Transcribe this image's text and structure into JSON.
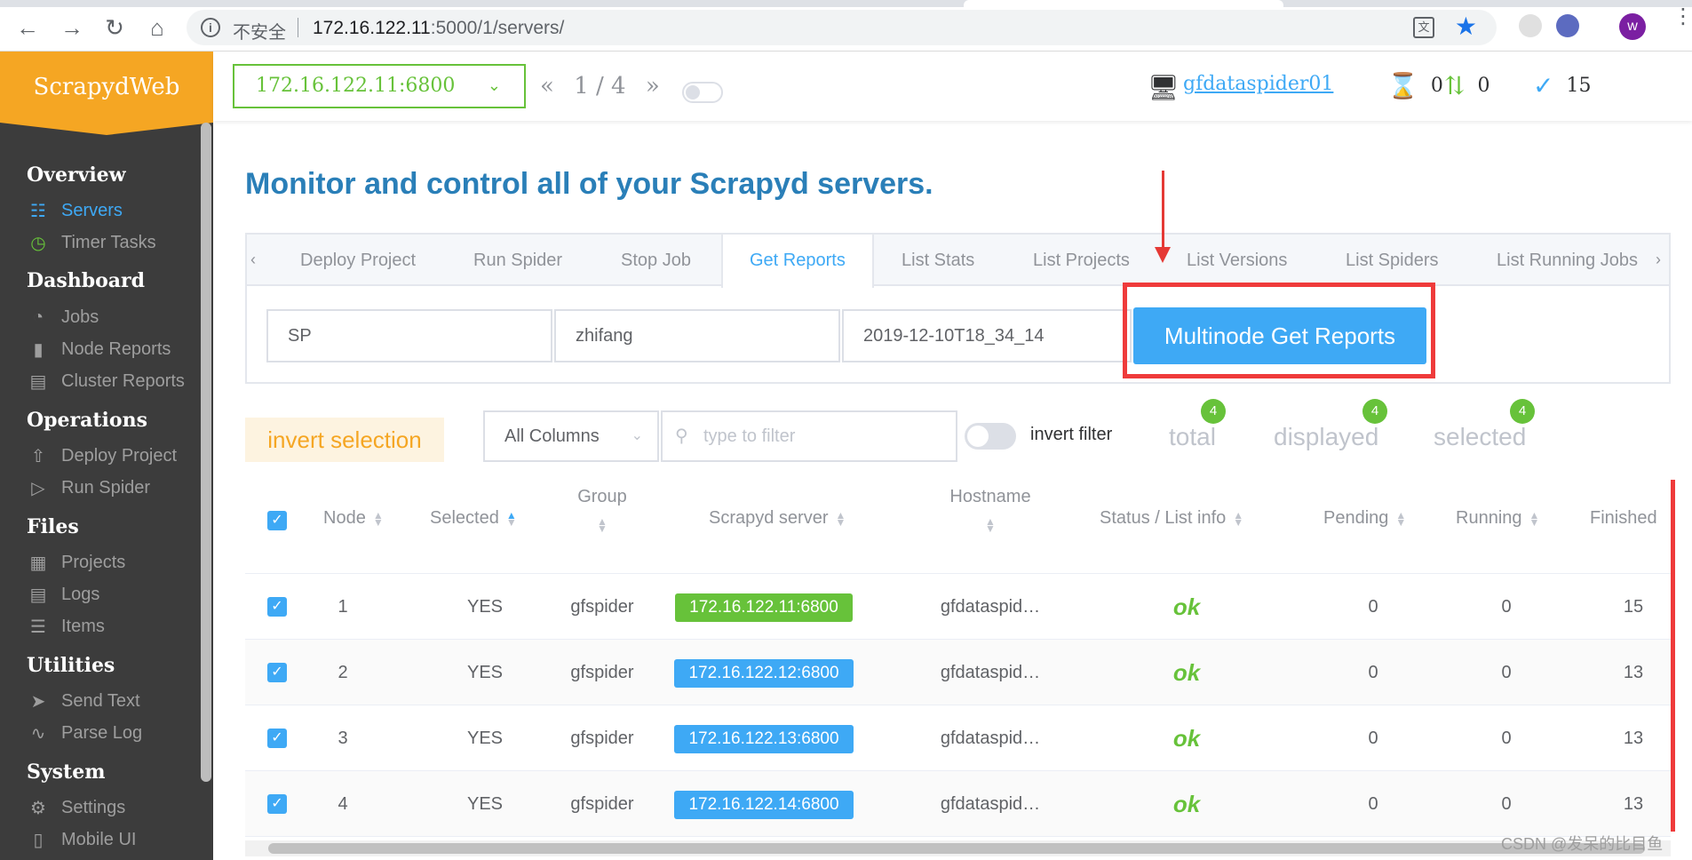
{
  "browser": {
    "insecure_label": "不安全",
    "url_host": "172.16.122.11",
    "url_rest": ":5000/1/servers/",
    "avatar_letter": "w"
  },
  "sidebar": {
    "logo": "ScrapydWeb",
    "sections": [
      {
        "title": "Overview",
        "items": [
          {
            "label": "Servers",
            "icon": "servers-icon"
          },
          {
            "label": "Timer Tasks",
            "icon": "timer-icon"
          }
        ]
      },
      {
        "title": "Dashboard",
        "items": [
          {
            "label": "Jobs",
            "icon": "dashboard-icon"
          },
          {
            "label": "Node Reports",
            "icon": "bar-chart-icon"
          },
          {
            "label": "Cluster Reports",
            "icon": "cluster-chart-icon"
          }
        ]
      },
      {
        "title": "Operations",
        "items": [
          {
            "label": "Deploy Project",
            "icon": "upload-icon"
          },
          {
            "label": "Run Spider",
            "icon": "play-icon"
          }
        ]
      },
      {
        "title": "Files",
        "items": [
          {
            "label": "Projects",
            "icon": "grid-icon"
          },
          {
            "label": "Logs",
            "icon": "document-icon"
          },
          {
            "label": "Items",
            "icon": "list-icon"
          }
        ]
      },
      {
        "title": "Utilities",
        "items": [
          {
            "label": "Send Text",
            "icon": "send-icon"
          },
          {
            "label": "Parse Log",
            "icon": "chart-line-icon"
          }
        ]
      },
      {
        "title": "System",
        "items": [
          {
            "label": "Settings",
            "icon": "gear-icon"
          },
          {
            "label": "Mobile UI",
            "icon": "mobile-icon"
          }
        ]
      }
    ]
  },
  "topbar": {
    "server": "172.16.122.11:6800",
    "pager": "1 / 4",
    "host": "gfdataspider01",
    "pending": "0",
    "running": "0",
    "finished": "15"
  },
  "main": {
    "headline": "Monitor and control all of your Scrapyd servers.",
    "tabs": [
      "Deploy Project",
      "Run Spider",
      "Stop Job",
      "Get Reports",
      "List Stats",
      "List Projects",
      "List Versions",
      "List Spiders",
      "List Running Jobs"
    ],
    "fields": {
      "project": "SP",
      "spider": "zhifang",
      "job": "2019-12-10T18_34_14"
    },
    "action_button": "Multinode Get Reports"
  },
  "filter": {
    "invert_selection": "invert selection",
    "columns": "All Columns",
    "placeholder": "type to filter",
    "invert_filter": "invert filter",
    "total_label": "total",
    "total": "4",
    "displayed_label": "displayed",
    "displayed": "4",
    "selected_label": "selected",
    "selected": "4"
  },
  "table": {
    "headers": {
      "node": "Node",
      "selected": "Selected",
      "group": "Group",
      "server": "Scrapyd server",
      "hostname": "Hostname",
      "status": "Status / List info",
      "pending": "Pending",
      "running": "Running",
      "finished": "Finished"
    },
    "rows": [
      {
        "node": "1",
        "selected": "YES",
        "group": "gfspider",
        "server": "172.16.122.11:6800",
        "server_color": "#67c23a",
        "hostname": "gfdataspid…",
        "status": "ok",
        "pending": "0",
        "running": "0",
        "finished": "15"
      },
      {
        "node": "2",
        "selected": "YES",
        "group": "gfspider",
        "server": "172.16.122.12:6800",
        "server_color": "#3ea9f5",
        "hostname": "gfdataspid…",
        "status": "ok",
        "pending": "0",
        "running": "0",
        "finished": "13"
      },
      {
        "node": "3",
        "selected": "YES",
        "group": "gfspider",
        "server": "172.16.122.13:6800",
        "server_color": "#3ea9f5",
        "hostname": "gfdataspid…",
        "status": "ok",
        "pending": "0",
        "running": "0",
        "finished": "13"
      },
      {
        "node": "4",
        "selected": "YES",
        "group": "gfspider",
        "server": "172.16.122.14:6800",
        "server_color": "#3ea9f5",
        "hostname": "gfdataspid…",
        "status": "ok",
        "pending": "0",
        "running": "0",
        "finished": "13"
      }
    ]
  },
  "watermark": "CSDN @发呆的比目鱼"
}
